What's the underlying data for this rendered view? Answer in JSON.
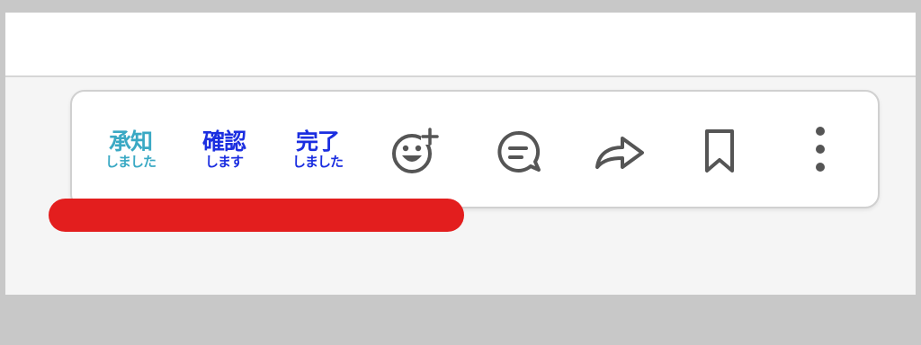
{
  "toolbar": {
    "stamps": [
      {
        "line1": "承知",
        "line2": "しました",
        "color": "#3aa9c4"
      },
      {
        "line1": "確認",
        "line2": "します",
        "color": "#1b2ee0"
      },
      {
        "line1": "完了",
        "line2": "しました",
        "color": "#1b2ee0"
      }
    ],
    "icons": [
      "add-reaction-icon",
      "comment-icon",
      "share-icon",
      "bookmark-icon",
      "more-options-icon"
    ],
    "icon_color": "#555555"
  },
  "overlay": {
    "redline_color": "#e31e1e"
  }
}
